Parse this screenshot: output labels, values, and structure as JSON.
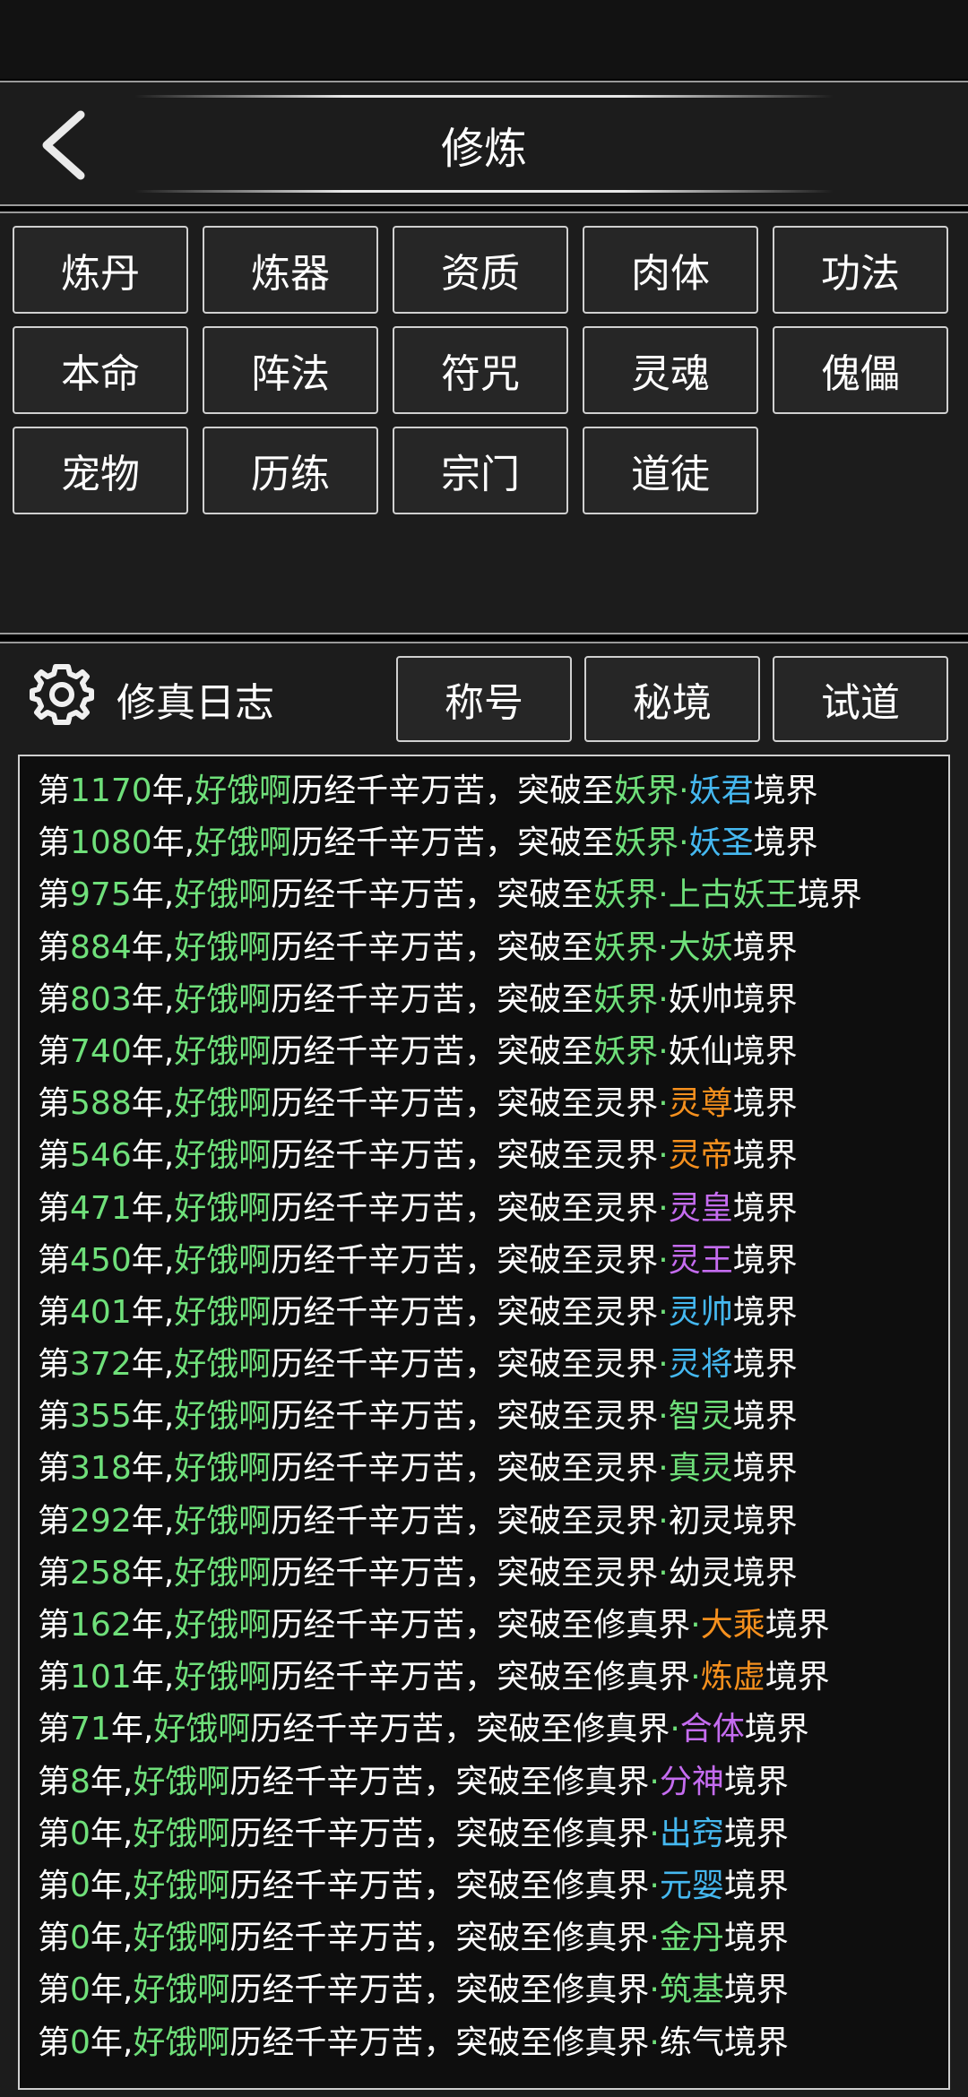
{
  "header": {
    "title": "修炼"
  },
  "menu": {
    "buttons": [
      "炼丹",
      "炼器",
      "资质",
      "肉体",
      "功法",
      "本命",
      "阵法",
      "符咒",
      "灵魂",
      "傀儡",
      "宠物",
      "历练",
      "宗门",
      "道徒"
    ]
  },
  "log": {
    "title": "修真日志",
    "tabs": [
      "称号",
      "秘境",
      "试道"
    ],
    "colors": {
      "green": "#6fe07a",
      "blue": "#45b8f0",
      "orange": "#f5901e",
      "purple": "#c56cf0",
      "white": "#ffffff"
    },
    "entries": [
      {
        "year": "1170",
        "name": "好饿啊",
        "mid": "历经千辛万苦，突破至",
        "realm": "妖界",
        "realm_color": "green",
        "sep": "·",
        "rank": "妖君",
        "rank_color": "blue",
        "tail": "境界"
      },
      {
        "year": "1080",
        "name": "好饿啊",
        "mid": "历经千辛万苦，突破至",
        "realm": "妖界",
        "realm_color": "green",
        "sep": "·",
        "rank": "妖圣",
        "rank_color": "blue",
        "tail": "境界"
      },
      {
        "year": "975",
        "name": "好饿啊",
        "mid": "历经千辛万苦，突破至",
        "realm": "妖界",
        "realm_color": "green",
        "sep": "·",
        "rank": "上古妖王",
        "rank_color": "green",
        "tail": "境界"
      },
      {
        "year": "884",
        "name": "好饿啊",
        "mid": "历经千辛万苦，突破至",
        "realm": "妖界",
        "realm_color": "green",
        "sep": "·",
        "rank": "大妖",
        "rank_color": "green",
        "tail": "境界"
      },
      {
        "year": "803",
        "name": "好饿啊",
        "mid": "历经千辛万苦，突破至",
        "realm": "妖界",
        "realm_color": "green",
        "sep": "·",
        "rank": "妖帅",
        "rank_color": "white",
        "tail": "境界"
      },
      {
        "year": "740",
        "name": "好饿啊",
        "mid": "历经千辛万苦，突破至",
        "realm": "妖界",
        "realm_color": "green",
        "sep": "·",
        "rank": "妖仙",
        "rank_color": "white",
        "tail": "境界"
      },
      {
        "year": "588",
        "name": "好饿啊",
        "mid": "历经千辛万苦，突破至",
        "realm": "灵界",
        "realm_color": "white",
        "sep": "·",
        "rank": "灵尊",
        "rank_color": "orange",
        "tail": "境界"
      },
      {
        "year": "546",
        "name": "好饿啊",
        "mid": "历经千辛万苦，突破至",
        "realm": "灵界",
        "realm_color": "white",
        "sep": "·",
        "rank": "灵帝",
        "rank_color": "orange",
        "tail": "境界"
      },
      {
        "year": "471",
        "name": "好饿啊",
        "mid": "历经千辛万苦，突破至",
        "realm": "灵界",
        "realm_color": "white",
        "sep": "·",
        "rank": "灵皇",
        "rank_color": "purple",
        "tail": "境界"
      },
      {
        "year": "450",
        "name": "好饿啊",
        "mid": "历经千辛万苦，突破至",
        "realm": "灵界",
        "realm_color": "white",
        "sep": "·",
        "rank": "灵王",
        "rank_color": "purple",
        "tail": "境界"
      },
      {
        "year": "401",
        "name": "好饿啊",
        "mid": "历经千辛万苦，突破至",
        "realm": "灵界",
        "realm_color": "white",
        "sep": "·",
        "rank": "灵帅",
        "rank_color": "blue",
        "tail": "境界"
      },
      {
        "year": "372",
        "name": "好饿啊",
        "mid": "历经千辛万苦，突破至",
        "realm": "灵界",
        "realm_color": "white",
        "sep": "·",
        "rank": "灵将",
        "rank_color": "blue",
        "tail": "境界"
      },
      {
        "year": "355",
        "name": "好饿啊",
        "mid": "历经千辛万苦，突破至",
        "realm": "灵界",
        "realm_color": "white",
        "sep": "·",
        "rank": "智灵",
        "rank_color": "green",
        "tail": "境界"
      },
      {
        "year": "318",
        "name": "好饿啊",
        "mid": "历经千辛万苦，突破至",
        "realm": "灵界",
        "realm_color": "white",
        "sep": "·",
        "rank": "真灵",
        "rank_color": "green",
        "tail": "境界"
      },
      {
        "year": "292",
        "name": "好饿啊",
        "mid": "历经千辛万苦，突破至",
        "realm": "灵界",
        "realm_color": "white",
        "sep": "·",
        "rank": "初灵",
        "rank_color": "white",
        "tail": "境界"
      },
      {
        "year": "258",
        "name": "好饿啊",
        "mid": "历经千辛万苦，突破至",
        "realm": "灵界",
        "realm_color": "white",
        "sep": "·",
        "rank": "幼灵",
        "rank_color": "white",
        "tail": "境界"
      },
      {
        "year": "162",
        "name": "好饿啊",
        "mid": "历经千辛万苦，突破至",
        "realm": "修真界",
        "realm_color": "white",
        "sep": "·",
        "rank": "大乘",
        "rank_color": "orange",
        "tail": "境界"
      },
      {
        "year": "101",
        "name": "好饿啊",
        "mid": "历经千辛万苦，突破至",
        "realm": "修真界",
        "realm_color": "white",
        "sep": "·",
        "rank": "炼虚",
        "rank_color": "orange",
        "tail": "境界"
      },
      {
        "year": "71",
        "name": "好饿啊",
        "mid": "历经千辛万苦，突破至",
        "realm": "修真界",
        "realm_color": "white",
        "sep": "·",
        "rank": "合体",
        "rank_color": "purple",
        "tail": "境界"
      },
      {
        "year": "8",
        "name": "好饿啊",
        "mid": "历经千辛万苦，突破至",
        "realm": "修真界",
        "realm_color": "white",
        "sep": "·",
        "rank": "分神",
        "rank_color": "purple",
        "tail": "境界"
      },
      {
        "year": "0",
        "name": "好饿啊",
        "mid": "历经千辛万苦，突破至",
        "realm": "修真界",
        "realm_color": "white",
        "sep": "·",
        "rank": "出窍",
        "rank_color": "blue",
        "tail": "境界"
      },
      {
        "year": "0",
        "name": "好饿啊",
        "mid": "历经千辛万苦，突破至",
        "realm": "修真界",
        "realm_color": "white",
        "sep": "·",
        "rank": "元婴",
        "rank_color": "blue",
        "tail": "境界"
      },
      {
        "year": "0",
        "name": "好饿啊",
        "mid": "历经千辛万苦，突破至",
        "realm": "修真界",
        "realm_color": "white",
        "sep": "·",
        "rank": "金丹",
        "rank_color": "green",
        "tail": "境界"
      },
      {
        "year": "0",
        "name": "好饿啊",
        "mid": "历经千辛万苦，突破至",
        "realm": "修真界",
        "realm_color": "white",
        "sep": "·",
        "rank": "筑基",
        "rank_color": "green",
        "tail": "境界"
      },
      {
        "year": "0",
        "name": "好饿啊",
        "mid": "历经千辛万苦，突破至",
        "realm": "修真界",
        "realm_color": "white",
        "sep": "·",
        "rank": "练气",
        "rank_color": "white",
        "tail": "境界"
      }
    ],
    "year_prefix": "第",
    "year_suffix": "年,"
  }
}
